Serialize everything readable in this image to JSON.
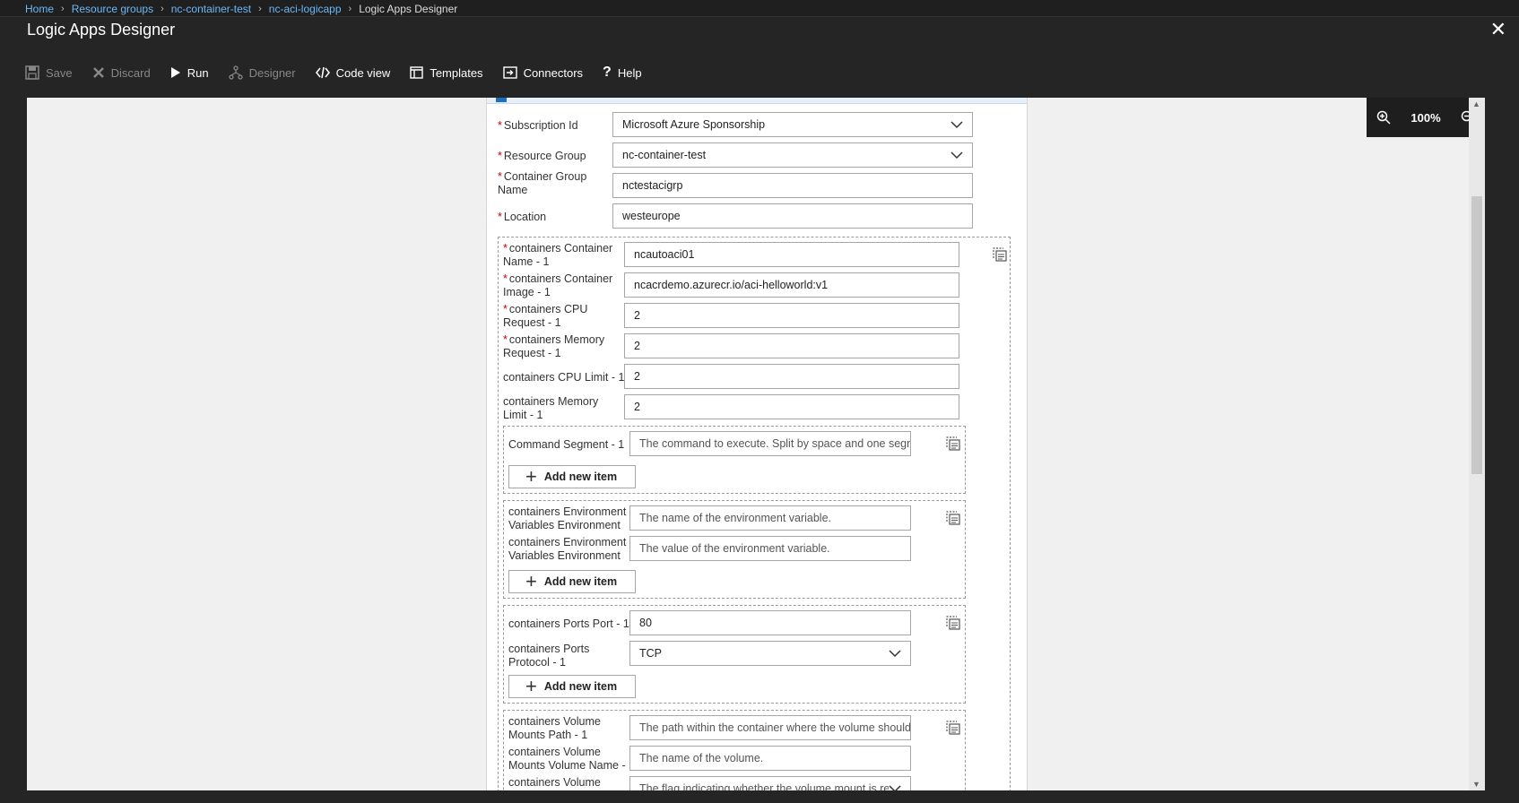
{
  "breadcrumb": {
    "items": [
      "Home",
      "Resource groups",
      "nc-container-test",
      "nc-aci-logicapp"
    ],
    "current": "Logic Apps Designer"
  },
  "window": {
    "title": "Logic Apps Designer",
    "close_icon": "close-icon"
  },
  "toolbar": {
    "save": "Save",
    "discard": "Discard",
    "run": "Run",
    "designer": "Designer",
    "code_view": "Code view",
    "templates": "Templates",
    "connectors": "Connectors",
    "help": "Help"
  },
  "zoom": {
    "level": "100%"
  },
  "form": {
    "subscription": {
      "label": "Subscription Id",
      "value": "Microsoft Azure Sponsorship"
    },
    "resource_group": {
      "label": "Resource Group",
      "value": "nc-container-test"
    },
    "container_group_name": {
      "label_line1": "Container Group",
      "label_line2": "Name",
      "value": "nctestacigrp"
    },
    "location": {
      "label": "Location",
      "value": "westeurope"
    },
    "container": {
      "name": {
        "l1": "containers Container",
        "l2": "Name - 1",
        "value": "ncautoaci01"
      },
      "image": {
        "l1": "containers Container",
        "l2": "Image - 1",
        "value": "ncacrdemo.azurecr.io/aci-helloworld:v1"
      },
      "cpu_request": {
        "l1": "containers CPU",
        "l2": "Request - 1",
        "value": "2"
      },
      "memory_request": {
        "l1": "containers Memory",
        "l2": "Request - 1",
        "value": "2"
      },
      "cpu_limit": {
        "label": "containers CPU Limit - 1",
        "value": "2"
      },
      "memory_limit": {
        "l1": "containers Memory",
        "l2": "Limit - 1",
        "value": "2"
      }
    },
    "command": {
      "label": "Command Segment - 1",
      "placeholder": "The command to execute. Split by space and one segm",
      "add": "Add new item"
    },
    "env": {
      "name": {
        "l1": "containers Environment",
        "l2": "Variables Environment",
        "placeholder": "The name of the environment variable."
      },
      "value": {
        "l1": "containers Environment",
        "l2": "Variables Environment",
        "placeholder": "The value of the environment variable."
      },
      "add": "Add new item"
    },
    "ports": {
      "port": {
        "label": "containers Ports Port - 1",
        "value": "80"
      },
      "protocol": {
        "l1": "containers Ports",
        "l2": "Protocol - 1",
        "value": "TCP"
      },
      "add": "Add new item"
    },
    "volumes": {
      "path": {
        "l1": "containers Volume",
        "l2": "Mounts Path - 1",
        "placeholder": "The path within the container where the volume should"
      },
      "name": {
        "l1": "containers Volume",
        "l2": "Mounts Volume Name -",
        "placeholder": "The name of the volume."
      },
      "readonly": {
        "l1": "containers Volume",
        "placeholder": "The flag indicating whether the volume mount is re"
      }
    }
  }
}
